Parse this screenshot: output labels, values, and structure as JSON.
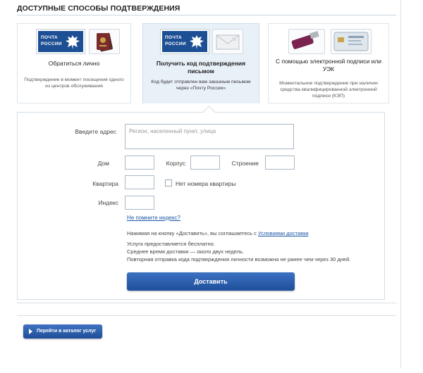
{
  "section_title": "ДОСТУПНЫЕ СПОСОБЫ ПОДТВЕРЖДЕНИЯ",
  "methods": [
    {
      "name": "Обратиться лично",
      "description": "Подтверждение в момент посещения одного из центров обслуживания",
      "logo_line1": "ПОЧТА",
      "logo_line2": "РОССИИ",
      "selected": false,
      "icons": [
        "pochta-rossii-logo",
        "passport-icon"
      ]
    },
    {
      "name": "Получить код подтверждения письмом",
      "description": "Код будет отправлен вам заказным письмом через «Почту России»",
      "logo_line1": "ПОЧТА",
      "logo_line2": "РОССИИ",
      "selected": true,
      "icons": [
        "pochta-rossii-logo",
        "envelope-icon"
      ]
    },
    {
      "name": "С помощью электронной подписи или УЭК",
      "description": "Моментальное подтверждение при наличии средства квалифицированной электронной подписи (КЭП)",
      "selected": false,
      "icons": [
        "usb-token-icon",
        "smart-card-icon"
      ]
    }
  ],
  "form": {
    "address_label": "Введите адрес",
    "address_placeholder": "Регион, населенный пункт, улица",
    "house_label": "Дом",
    "korpus_label": "Корпус",
    "building_label": "Строение",
    "apartment_label": "Квартира",
    "no_apartment_label": "Нет номера квартиры",
    "index_label": "Индекс",
    "forgot_index_link": "Не помните индекс?",
    "agreement_text": "Нажимая на кнопку «Доставить», вы соглашаетесь с",
    "agreement_link": "Условиями доставки",
    "info_line1": "Услуга предоставляется бесплатно.",
    "info_line2": "Среднее время доставки — около двух недель.",
    "info_line3": "Повторная отправка кода подтверждения личности возможна не ранее чем через 30 дней.",
    "submit_label": "Доставить"
  },
  "catalog_button_label": "Перейти в каталог услуг",
  "colors": {
    "brand_blue": "#1c4f93",
    "button_blue": "#1f4f9b",
    "link_blue": "#1a57a6",
    "selected_card_bg": "#e9f1f8"
  }
}
